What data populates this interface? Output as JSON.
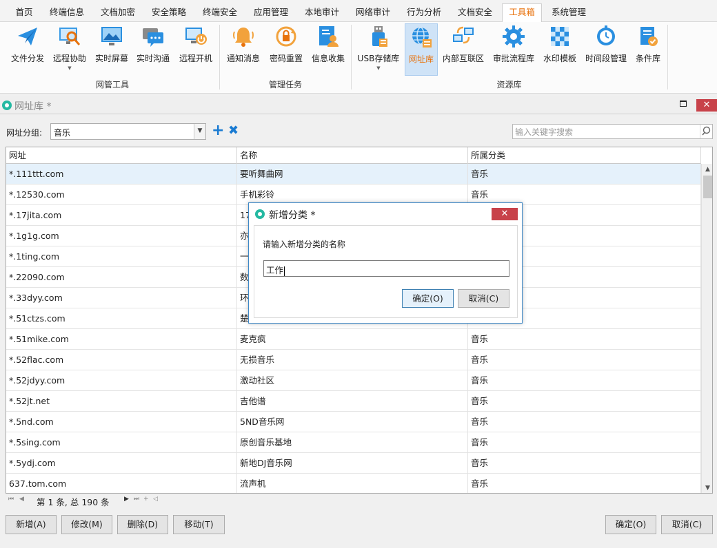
{
  "menu_tabs": [
    "首页",
    "终端信息",
    "文档加密",
    "安全策略",
    "终端安全",
    "应用管理",
    "本地审计",
    "网络审计",
    "行为分析",
    "文档安全",
    "工具箱",
    "系统管理"
  ],
  "active_menu_tab": "工具箱",
  "ribbon": {
    "groups": [
      {
        "label": "网管工具",
        "items": [
          "文件分发",
          "远程协助",
          "实时屏幕",
          "实时沟通",
          "远程开机"
        ]
      },
      {
        "label": "管理任务",
        "items": [
          "通知消息",
          "密码重置",
          "信息收集"
        ]
      },
      {
        "label": "资源库",
        "items": [
          "USB存储库",
          "网址库",
          "内部互联区",
          "审批流程库",
          "水印模板",
          "时间段管理",
          "条件库"
        ]
      }
    ],
    "active_item": "网址库"
  },
  "window": {
    "title": "网址库 *",
    "close_glyph": "✕"
  },
  "filter": {
    "label": "网址分组:",
    "selected_group": "音乐",
    "search_placeholder": "输入关键字搜索"
  },
  "table": {
    "columns": [
      "网址",
      "名称",
      "所属分类"
    ],
    "rows": [
      [
        "*.111ttt.com",
        "要听舞曲网",
        "音乐"
      ],
      [
        "*.12530.com",
        "手机彩铃",
        "音乐"
      ],
      [
        "*.17jita.com",
        "17",
        ""
      ],
      [
        "*.1g1g.com",
        "亦",
        ""
      ],
      [
        "*.1ting.com",
        "一",
        ""
      ],
      [
        "*.22090.com",
        "数",
        ""
      ],
      [
        "*.33dyy.com",
        "环",
        ""
      ],
      [
        "*.51ctzs.com",
        "楚",
        ""
      ],
      [
        "*.51mike.com",
        "麦克疯",
        "音乐"
      ],
      [
        "*.52flac.com",
        "无损音乐",
        "音乐"
      ],
      [
        "*.52jdyy.com",
        "激动社区",
        "音乐"
      ],
      [
        "*.52jt.net",
        "吉他谱",
        "音乐"
      ],
      [
        "*.5nd.com",
        "5ND音乐网",
        "音乐"
      ],
      [
        "*.5sing.com",
        "原创音乐基地",
        "音乐"
      ],
      [
        "*.5ydj.com",
        "新地DJ音乐网",
        "音乐"
      ],
      [
        "637.tom.com",
        "流声机",
        "音乐"
      ]
    ]
  },
  "pager": {
    "text": "第 1 条, 总 190 条"
  },
  "bottom_buttons": {
    "add": "新增(A)",
    "edit": "修改(M)",
    "delete": "删除(D)",
    "move": "移动(T)",
    "ok": "确定(O)",
    "cancel": "取消(C)"
  },
  "dialog": {
    "title": "新增分类 *",
    "prompt": "请输入新增分类的名称",
    "input_value": "工作",
    "ok": "确定(O)",
    "cancel": "取消(C)",
    "close_glyph": "✕"
  },
  "colors": {
    "accent_orange": "#e8720c",
    "accent_blue": "#1a7bd2",
    "close_red": "#c8424a",
    "selection": "#e5f1fb"
  }
}
